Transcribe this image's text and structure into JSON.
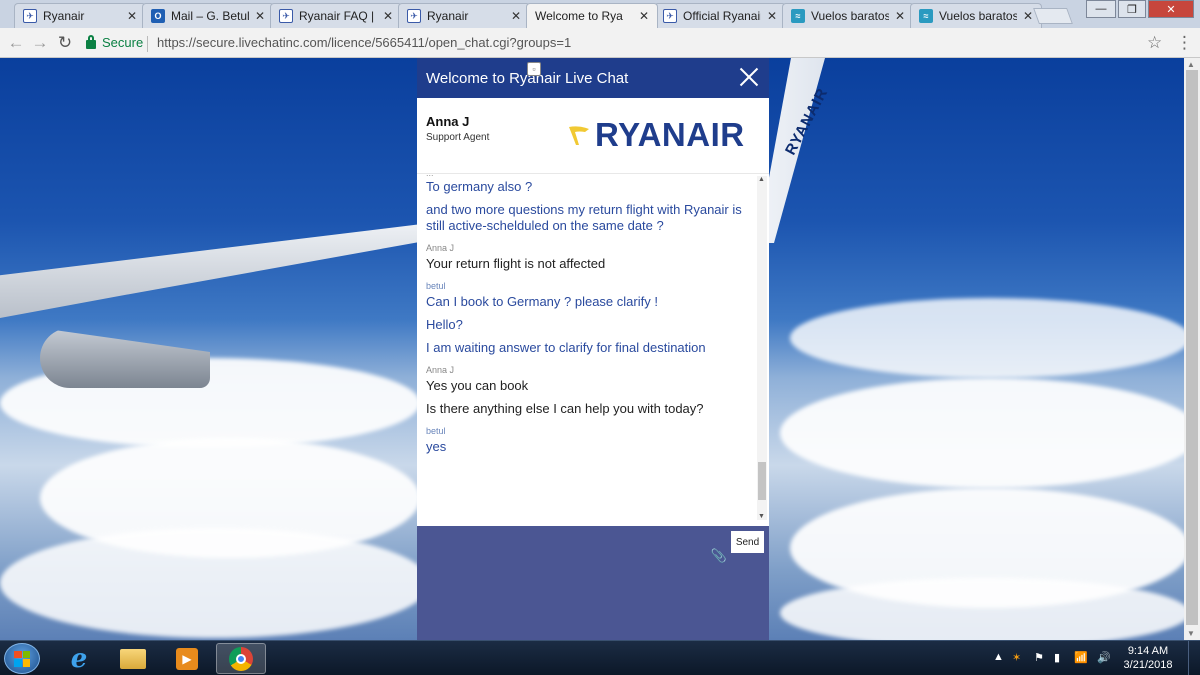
{
  "browser": {
    "tabs": [
      {
        "label": "Ryanair",
        "favicon": "ryanair-icon",
        "active": false
      },
      {
        "label": "Mail – G. Betul A",
        "favicon": "outlook-icon",
        "active": false
      },
      {
        "label": "Ryanair FAQ | Fr",
        "favicon": "ryanair-icon",
        "active": false
      },
      {
        "label": "Ryanair",
        "favicon": "ryanair-icon",
        "active": false
      },
      {
        "label": "Welcome to Rya",
        "favicon": "page-icon",
        "active": true
      },
      {
        "label": "Official Ryanair",
        "favicon": "ryanair-icon",
        "active": false
      },
      {
        "label": "Vuelos baratos",
        "favicon": "vuelos-icon",
        "active": false
      },
      {
        "label": "Vuelos baratos",
        "favicon": "vuelos-icon",
        "active": false
      }
    ],
    "secure_label": "Secure",
    "url": "https://secure.livechatinc.com/licence/5665411/open_chat.cgi?groups=1"
  },
  "background": {
    "winglet_text": "RYANAIR"
  },
  "chat": {
    "title": "Welcome to Ryanair Live Chat",
    "agent_name": "Anna J",
    "agent_role": "Support Agent",
    "logo_text": "RYANAIR",
    "truncated_marker": "...",
    "groups": [
      {
        "author": "",
        "role": "user",
        "messages": [
          "To germany also ?",
          "and two more questions my return flight with Ryanair is still active-schelduled on the same date ?"
        ]
      },
      {
        "author": "Anna J",
        "role": "agent",
        "messages": [
          "Your return flight is not affected"
        ]
      },
      {
        "author": "betul",
        "role": "user",
        "messages": [
          "Can I book to Germany ? please clarify !",
          "Hello?",
          "I am waiting answer to clarify for final destination"
        ]
      },
      {
        "author": "Anna J",
        "role": "agent",
        "messages": [
          "Yes you can book",
          "Is there anything else I can help you with today?"
        ]
      },
      {
        "author": "betul",
        "role": "user",
        "messages": [
          "yes"
        ]
      }
    ],
    "send_label": "Send"
  },
  "taskbar": {
    "time": "9:14 AM",
    "date": "3/21/2018",
    "pinned": [
      "internet-explorer-icon",
      "file-explorer-icon",
      "media-player-icon",
      "chrome-icon"
    ]
  },
  "colors": {
    "chat_header": "#1f3d8c",
    "compose_area": "#4b5693",
    "user_text": "#2a4a9e",
    "secure_green": "#0b8043"
  }
}
